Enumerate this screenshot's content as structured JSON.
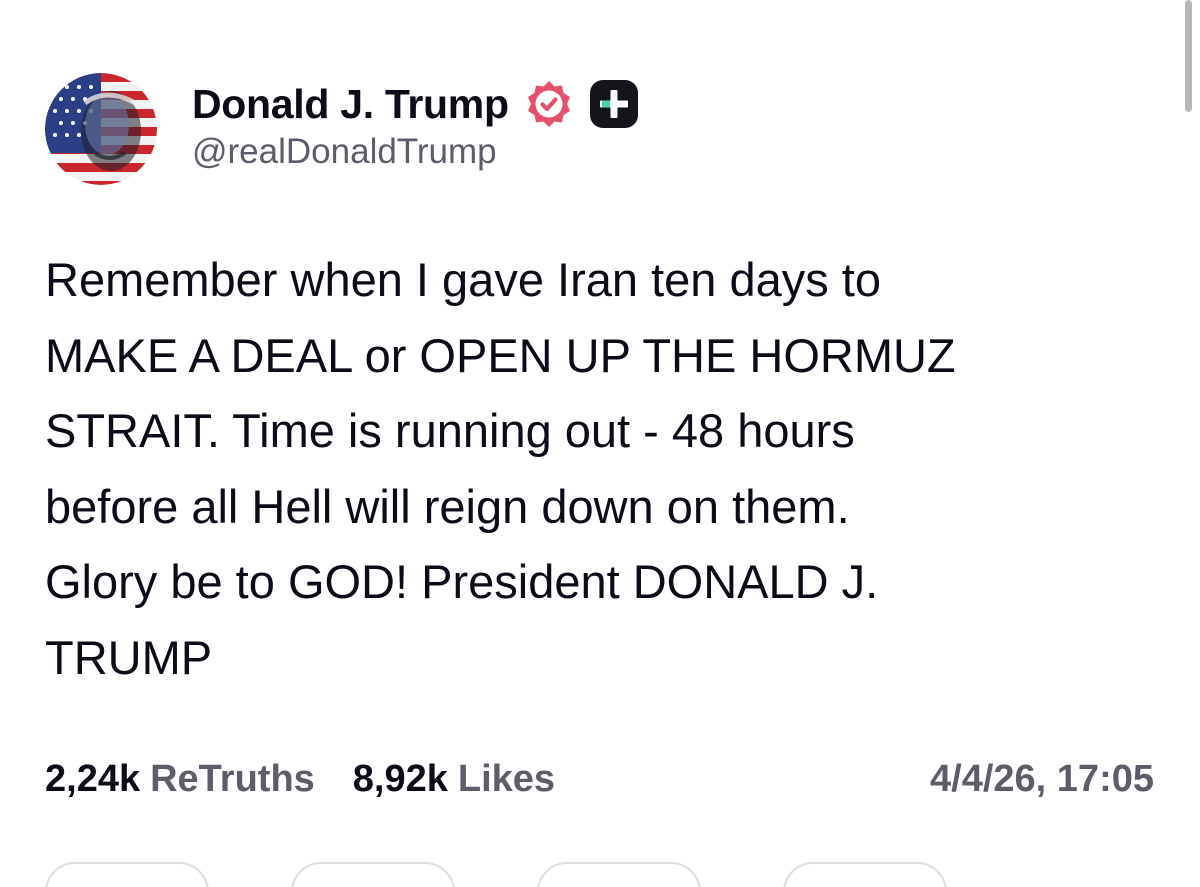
{
  "author": {
    "display_name": "Donald J. Trump",
    "handle": "@realDonaldTrump",
    "avatar": "avatar-flag-portrait",
    "verified_icon": "verified-badge-icon",
    "plus_icon": "plus-badge-icon"
  },
  "post": {
    "text": "Remember when I gave Iran ten days to\nMAKE A DEAL or OPEN UP THE HORMUZ\nSTRAIT. Time is running out - 48 hours\nbefore all Hell will reign down on them.\nGlory be to GOD! President DONALD J.\nTRUMP"
  },
  "stats": {
    "retruths_count": "2,24k",
    "retruths_label": "ReTruths",
    "likes_count": "8,92k",
    "likes_label": "Likes",
    "timestamp": "4/4/26, 17:05"
  },
  "colors": {
    "verified": "#e5506b",
    "text": "#0c0c18",
    "muted": "#5d5d6a"
  }
}
